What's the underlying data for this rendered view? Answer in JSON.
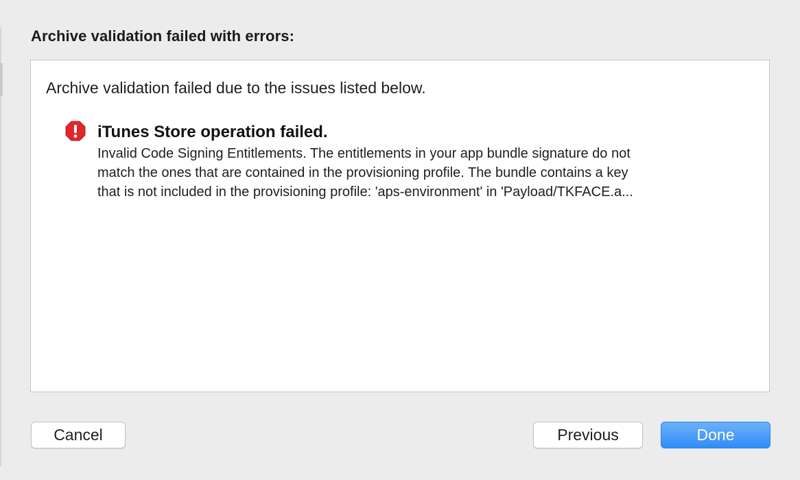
{
  "sheet": {
    "title": "Archive validation failed with errors:",
    "summary": "Archive validation failed due to the issues listed below.",
    "issues": [
      {
        "icon": "error-octagon-icon",
        "icon_color": "#e0262b",
        "title": "iTunes Store operation failed.",
        "message_lines": [
          "Invalid Code Signing Entitlements. The entitlements in your app bundle signature do not",
          "match the ones that are contained in the provisioning profile. The bundle contains a key",
          "that is not included in the provisioning profile: 'aps-environment' in 'Payload/TKFACE.a..."
        ]
      }
    ]
  },
  "buttons": {
    "cancel": "Cancel",
    "previous": "Previous",
    "done": "Done"
  },
  "colors": {
    "primary_button": "#2f8cf8",
    "background": "#ececec"
  }
}
